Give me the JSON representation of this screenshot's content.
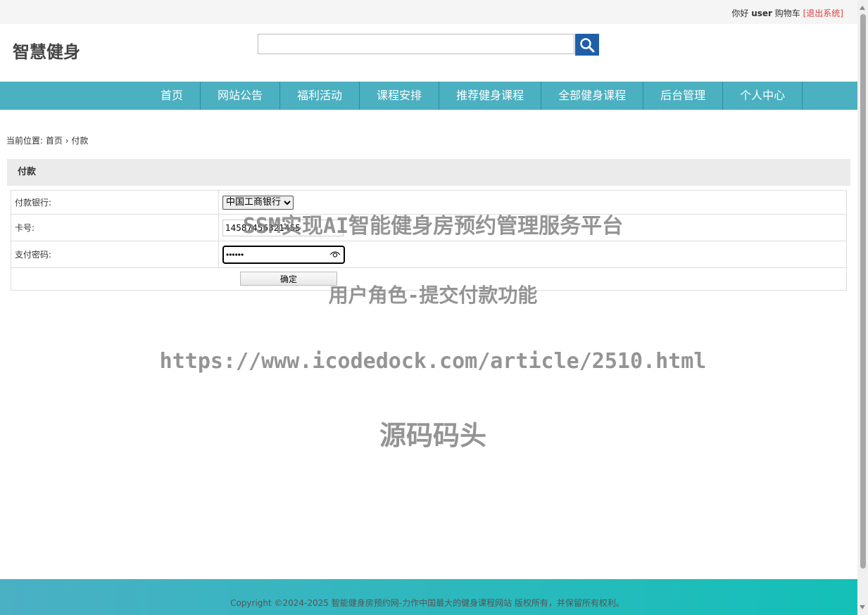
{
  "topbar": {
    "greeting": "你好",
    "username": "user",
    "cart": "购物车",
    "logout": "[退出系统]"
  },
  "header": {
    "logo": "智慧健身",
    "search_value": "",
    "search_icon": "search-icon"
  },
  "nav": {
    "items": [
      "首页",
      "网站公告",
      "福利活动",
      "课程安排",
      "推荐健身课程",
      "全部健身课程",
      "后台管理",
      "个人中心"
    ]
  },
  "breadcrumb": {
    "prefix": "当前位置:",
    "home": "首页",
    "separator": "›",
    "current": "付款"
  },
  "panel": {
    "title": "付款"
  },
  "form": {
    "bank_label": "付款银行:",
    "bank_selected": "中国工商银行",
    "card_label": "卡号:",
    "card_value": "14587456321455",
    "password_label": "支付密码:",
    "password_value": "••••••",
    "submit_label": "确定"
  },
  "watermark": {
    "line1": "SSM实现AI智能健身房预约管理服务平台",
    "line2": "用户角色-提交付款功能",
    "line3": "https://www.icodedock.com/article/2510.html",
    "line4": "源码码头"
  },
  "footer": {
    "copyright": "Copyright ©2024-2025 智能健身房预约网-力作中国最大的健身课程网站 版权所有，并保留所有权利。"
  },
  "colors": {
    "nav_bg": "#4bb0c0",
    "search_button": "#1f5fa8",
    "logout": "#e04040"
  }
}
